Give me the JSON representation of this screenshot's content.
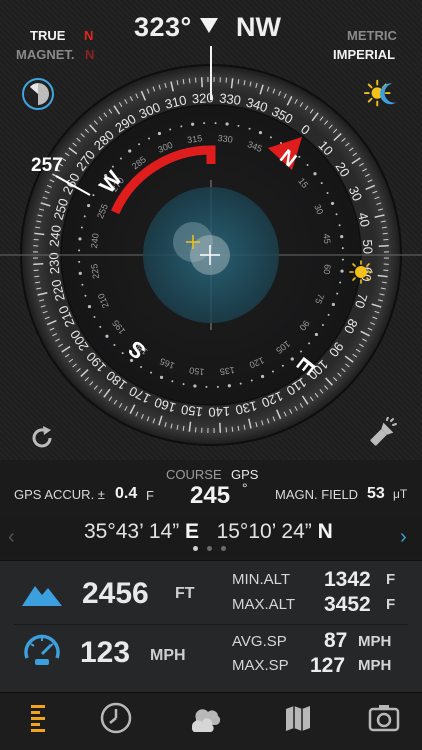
{
  "header": {
    "heading_value": "323°",
    "heading_direction": "NW",
    "reference": {
      "true_label": "TRUE",
      "true_mark": "N",
      "magnetic_label": "MAGNET.",
      "magnetic_mark": "N"
    },
    "units": {
      "metric": "METRIC",
      "imperial": "IMPERIAL"
    }
  },
  "compass": {
    "outer_ticks": [
      "0",
      "10",
      "20",
      "30",
      "40",
      "50",
      "60",
      "70",
      "80",
      "90",
      "100",
      "110",
      "120",
      "130",
      "140",
      "150",
      "160",
      "170",
      "180",
      "190",
      "200",
      "210",
      "220",
      "230",
      "240",
      "250",
      "260",
      "270",
      "280",
      "290",
      "300",
      "310",
      "320",
      "330",
      "340",
      "350"
    ],
    "inner_ticks": [
      "15",
      "30",
      "45",
      "60",
      "75",
      "90",
      "105",
      "120",
      "135",
      "150",
      "165",
      "180",
      "195",
      "210",
      "225",
      "240",
      "255",
      "270",
      "285",
      "300",
      "315",
      "330",
      "345"
    ],
    "cardinals": {
      "north": "N",
      "east": "E",
      "south": "S",
      "west": "W"
    },
    "bearing_marker": "257",
    "colors": {
      "accent_red": "#e01d1d",
      "center_blue": "#1f4b5c",
      "sun": "#f2c21b",
      "moon": "#3da0de"
    }
  },
  "course": {
    "label": "COURSE",
    "source": "GPS",
    "value": "245",
    "degree_symbol": "°"
  },
  "gps_accuracy": {
    "label": "GPS ACCUR. ±",
    "value": "0.4",
    "unit": "F"
  },
  "magnetic_field": {
    "label": "MAGN. FIELD",
    "value": "53",
    "unit": "μT"
  },
  "coordinates": {
    "lat_value": "35°43’ 14”",
    "lat_dir": "E",
    "lon_value": "15°10’ 24”",
    "lon_dir": "N",
    "page_count": 3,
    "active_page": 1
  },
  "altitude": {
    "value": "2456",
    "unit": "FT",
    "min_label": "MIN.ALT",
    "min_value": "1342",
    "min_unit": "F",
    "max_label": "MAX.ALT",
    "max_value": "3452",
    "max_unit": "F"
  },
  "speed": {
    "value": "123",
    "unit": "MPH",
    "avg_label": "AVG.SP",
    "avg_value": "87",
    "avg_unit": "MPH",
    "max_label": "MAX.SP",
    "max_value": "127",
    "max_unit": "MPH"
  },
  "tabs": [
    {
      "name": "compass-tab",
      "icon": "bars-icon",
      "active": true
    },
    {
      "name": "clock-tab",
      "icon": "clock-icon",
      "active": false
    },
    {
      "name": "weather-tab",
      "icon": "clouds-icon",
      "active": false
    },
    {
      "name": "map-tab",
      "icon": "map-icon",
      "active": false
    },
    {
      "name": "camera-tab",
      "icon": "camera-icon",
      "active": false
    }
  ]
}
